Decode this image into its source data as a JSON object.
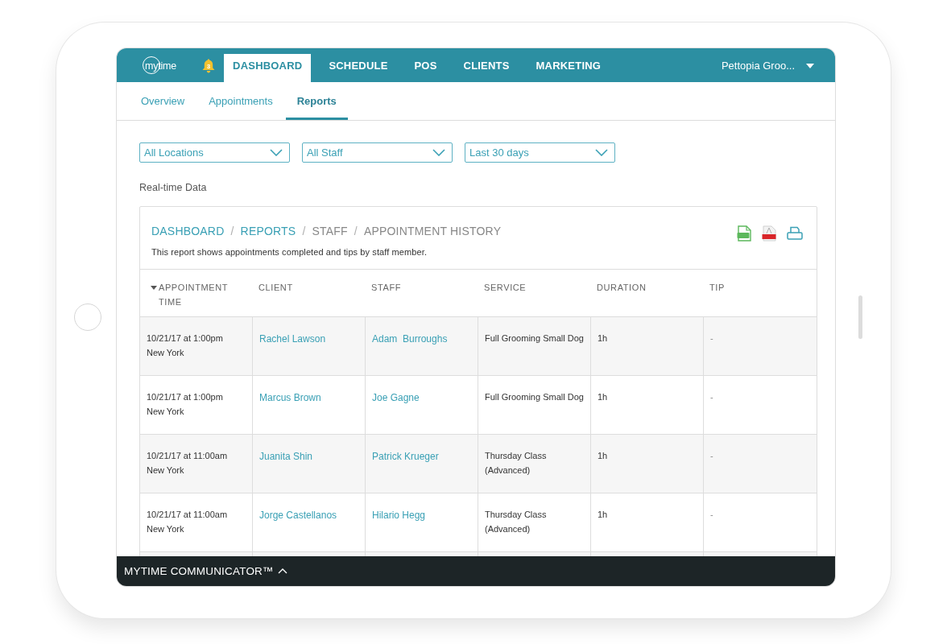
{
  "nav": {
    "logo": "mytime",
    "notifications": {
      "count": "3"
    },
    "tabs": [
      {
        "label": "DASHBOARD",
        "selected": true
      },
      {
        "label": "SCHEDULE",
        "selected": false
      },
      {
        "label": "POS",
        "selected": false
      },
      {
        "label": "CLIENTS",
        "selected": false
      },
      {
        "label": "MARKETING",
        "selected": false
      }
    ],
    "account": "Pettopia Groo..."
  },
  "subnav": [
    {
      "label": "Overview",
      "selected": false
    },
    {
      "label": "Appointments",
      "selected": false
    },
    {
      "label": "Reports",
      "selected": true
    }
  ],
  "filters": [
    "All Locations",
    "All Staff",
    "Last 30 days"
  ],
  "data_note": "Real-time Data",
  "report": {
    "breadcrumb": [
      {
        "label": "DASHBOARD",
        "kind": "link"
      },
      {
        "label": "/",
        "kind": "separator"
      },
      {
        "label": "REPORTS",
        "kind": "link"
      },
      {
        "label": "/",
        "kind": "separator"
      },
      {
        "label": "STAFF",
        "kind": "text"
      },
      {
        "label": "/",
        "kind": "separator"
      },
      {
        "label": "APPOINTMENT HISTORY",
        "kind": "text"
      }
    ],
    "description": "This report shows appointments completed and tips by staff member.",
    "columns": [
      {
        "label": "APPOINTMENT TIME",
        "sorted": true
      },
      {
        "label": "CLIENT",
        "sorted": false
      },
      {
        "label": "STAFF",
        "sorted": false
      },
      {
        "label": "SERVICE",
        "sorted": false
      },
      {
        "label": "DURATION",
        "sorted": false
      },
      {
        "label": "TIP",
        "sorted": false
      }
    ],
    "rows": [
      {
        "time": "10/21/17 at 1:00pm",
        "location": "New York",
        "client": "Rachel Lawson",
        "staff": "Adam  Burroughs",
        "service": "Full Grooming Small Dog",
        "duration": "1h",
        "tip": "-"
      },
      {
        "time": "10/21/17 at 1:00pm",
        "location": "New York",
        "client": "Marcus Brown",
        "staff": "Joe Gagne",
        "service": "Full Grooming Small Dog",
        "duration": "1h",
        "tip": "-"
      },
      {
        "time": "10/21/17 at 11:00am",
        "location": "New York",
        "client": "Juanita Shin",
        "staff": "Patrick Krueger",
        "service": "Thursday Class (Advanced)",
        "duration": "1h",
        "tip": "-"
      },
      {
        "time": "10/21/17 at 11:00am",
        "location": "New York",
        "client": "Jorge Castellanos",
        "staff": "Hilario Hegg",
        "service": "Thursday Class (Advanced)",
        "duration": "1h",
        "tip": "-"
      }
    ]
  },
  "communicator": {
    "label": "MYTIME COMMUNICATOR™"
  }
}
